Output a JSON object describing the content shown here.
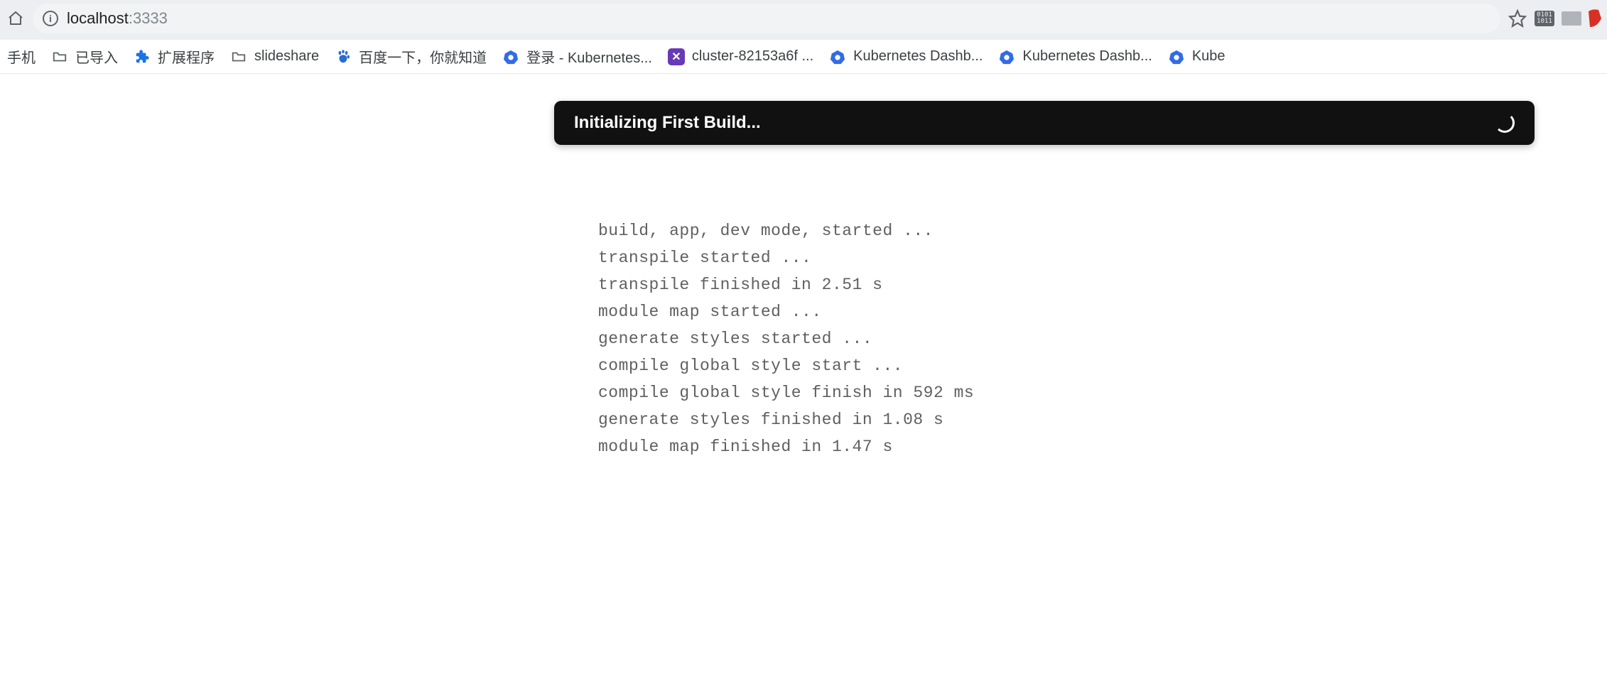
{
  "omnibox": {
    "host": "localhost",
    "port": ":3333",
    "ext_pill_text": "0101\n1011"
  },
  "bookmarks": [
    {
      "id": "mobile",
      "label": "手机",
      "icon": "none"
    },
    {
      "id": "imported",
      "label": "已导入",
      "icon": "folder"
    },
    {
      "id": "extensions",
      "label": "扩展程序",
      "icon": "puzzle"
    },
    {
      "id": "slideshare",
      "label": "slideshare",
      "icon": "folder"
    },
    {
      "id": "baidu",
      "label": "百度一下，你就知道",
      "icon": "baidu"
    },
    {
      "id": "k8s-login",
      "label": "登录 - Kubernetes...",
      "icon": "k8s"
    },
    {
      "id": "cluster",
      "label": "cluster-82153a6f ...",
      "icon": "x"
    },
    {
      "id": "k8s-dash1",
      "label": "Kubernetes Dashb...",
      "icon": "k8s"
    },
    {
      "id": "k8s-dash2",
      "label": "Kubernetes Dashb...",
      "icon": "k8s"
    },
    {
      "id": "k8s-more",
      "label": "Kube",
      "icon": "k8s"
    }
  ],
  "banner": {
    "title": "Initializing First Build..."
  },
  "log_lines": [
    "build, app, dev mode, started ...",
    "transpile started ...",
    "transpile finished in 2.51 s",
    "module map started ...",
    "generate styles started ...",
    "compile global style start ...",
    "compile global style finish in 592 ms",
    "generate styles finished in 1.08 s",
    "module map finished in 1.47 s"
  ]
}
